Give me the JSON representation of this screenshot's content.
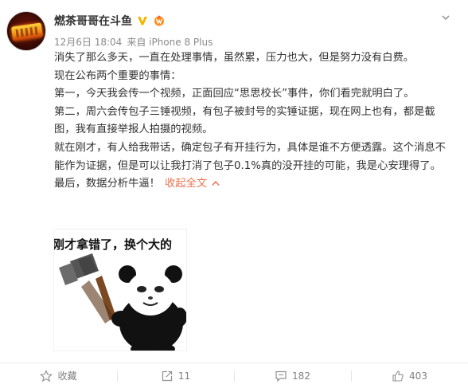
{
  "post": {
    "username": "燃茶哥哥在斗鱼",
    "verified_icon": "verified-v-icon",
    "vip_icon": "vip-member-icon",
    "date": "12月6日 18:04",
    "source": "来自 iPhone 8 Plus",
    "paragraphs": [
      "消失了那么多天，一直在处理事情，虽然累，压力也大，但是努力没有白费。",
      "现在公布两个重要的事情：",
      "第一，今天我会传一个视频，正面回应“思思校长”事件，你们看完就明白了。",
      "第二，周六会传包子三锤视频，有包子被封号的实锤证据，现在网上也有，都是截图，我有直接举报人拍摄的视频。",
      "就在刚才，有人给我带话，确定包子有开挂行为，具体是谁不方便透露。这个消息不能作为证据，但是可以让我打消了包子0.1%真的没开挂的可能，我是心安理得了。",
      "最后，数据分析牛逼！"
    ],
    "collapse_label": "收起全文",
    "meme_caption": "刚才拿错了，换个大的"
  },
  "actions": {
    "favorite_label": "收藏",
    "repost_count": "11",
    "comment_count": "182",
    "like_count": "403"
  },
  "colors": {
    "link": "#eb7350",
    "verified": "#f7b500",
    "text": "#333333",
    "muted": "#808080"
  }
}
